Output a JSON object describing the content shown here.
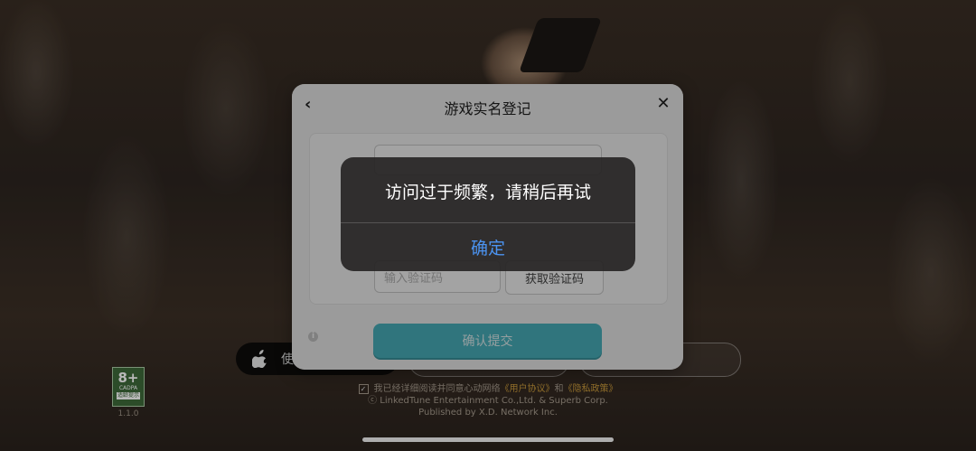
{
  "dialog": {
    "title": "游戏实名登记",
    "name_placeholder": "",
    "code_placeholder": "输入验证码",
    "get_code_label": "获取验证码",
    "submit_label": "确认提交"
  },
  "alert": {
    "message": "访问过于频繁，请稍后再试",
    "confirm_label": "确定"
  },
  "login": {
    "apple_label": "使"
  },
  "rating": {
    "age": "8+",
    "org": "CADPA",
    "tip": "适龄提示"
  },
  "version": "1.1.0",
  "legal": {
    "agree_text": "我已经详细阅读并同意心动网络",
    "user_agreement": "《用户协议》",
    "and": "和",
    "privacy_policy": "《隐私政策》",
    "copyright": "ⓒ LinkedTune Entertainment Co.,Ltd. & Superb Corp.",
    "publisher": "Published by X.D. Network Inc."
  },
  "colors": {
    "submit": "#4bb8c4",
    "alert_button": "#4b93f0",
    "link": "#c99a3c"
  }
}
